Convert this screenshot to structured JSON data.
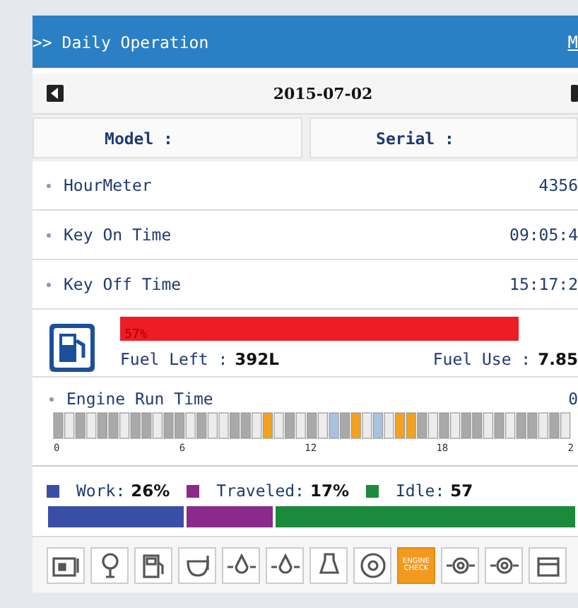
{
  "header": {
    "title": ">> Daily Operation",
    "link": "M"
  },
  "date_bar": {
    "date": "2015-07-02"
  },
  "info": {
    "model": "Model :",
    "serial": "Serial :"
  },
  "rows": [
    {
      "label": "HourMeter",
      "value": "4356"
    },
    {
      "label": "Key On Time",
      "value": "09:05:4"
    },
    {
      "label": "Key Off Time",
      "value": "15:17:2"
    }
  ],
  "fuel": {
    "percent": "57%",
    "left_label": "Fuel Left :",
    "left_value": "392L",
    "use_label": "Fuel Use :",
    "use_value": "7.85"
  },
  "engine_run": {
    "label": "Engine Run Time",
    "value": "0",
    "cells": [
      {
        "kind": "idle"
      },
      {
        "kind": "off"
      },
      {
        "kind": "idle"
      },
      {
        "kind": "off"
      },
      {
        "kind": "idle"
      },
      {
        "kind": "idle"
      },
      {
        "kind": "off"
      },
      {
        "kind": "idle"
      },
      {
        "kind": "idle"
      },
      {
        "kind": "off"
      },
      {
        "kind": "idle"
      },
      {
        "kind": "idle"
      },
      {
        "kind": "off"
      },
      {
        "kind": "idle"
      },
      {
        "kind": "off"
      },
      {
        "kind": "off"
      },
      {
        "kind": "idle"
      },
      {
        "kind": "idle"
      },
      {
        "kind": "off"
      },
      {
        "kind": "work"
      },
      {
        "kind": "off"
      },
      {
        "kind": "idle"
      },
      {
        "kind": "off"
      },
      {
        "kind": "idle"
      },
      {
        "kind": "off"
      },
      {
        "kind": "travel"
      },
      {
        "kind": "idle"
      },
      {
        "kind": "work"
      },
      {
        "kind": "off"
      },
      {
        "kind": "travel"
      },
      {
        "kind": "off"
      },
      {
        "kind": "work"
      },
      {
        "kind": "work"
      },
      {
        "kind": "idle"
      },
      {
        "kind": "off"
      },
      {
        "kind": "idle"
      },
      {
        "kind": "off"
      },
      {
        "kind": "idle"
      },
      {
        "kind": "idle"
      },
      {
        "kind": "off"
      },
      {
        "kind": "idle"
      },
      {
        "kind": "off"
      },
      {
        "kind": "idle"
      },
      {
        "kind": "idle"
      },
      {
        "kind": "off"
      },
      {
        "kind": "idle"
      },
      {
        "kind": "off"
      }
    ],
    "ticks": [
      "0",
      "6",
      "12",
      "18",
      "2"
    ]
  },
  "usage": [
    {
      "label": "Work:",
      "value": "26%",
      "color": "#3a4ea6"
    },
    {
      "label": "Traveled:",
      "value": "17%",
      "color": "#8a2b8c"
    },
    {
      "label": "Idle:",
      "value": "57",
      "color": "#1c8a3c"
    }
  ],
  "status_icons": [
    {
      "kind": "battery",
      "on": false
    },
    {
      "kind": "bulb",
      "on": false
    },
    {
      "kind": "fuel",
      "on": false
    },
    {
      "kind": "oil",
      "on": false
    },
    {
      "kind": "drop",
      "on": false
    },
    {
      "kind": "drop2",
      "on": false
    },
    {
      "kind": "flask",
      "on": false
    },
    {
      "kind": "circle",
      "on": false
    },
    {
      "kind": "engine",
      "on": true,
      "label": "ENGINE CHECK"
    },
    {
      "kind": "gear",
      "on": false
    },
    {
      "kind": "gear2",
      "on": false
    },
    {
      "kind": "box",
      "on": false
    }
  ]
}
